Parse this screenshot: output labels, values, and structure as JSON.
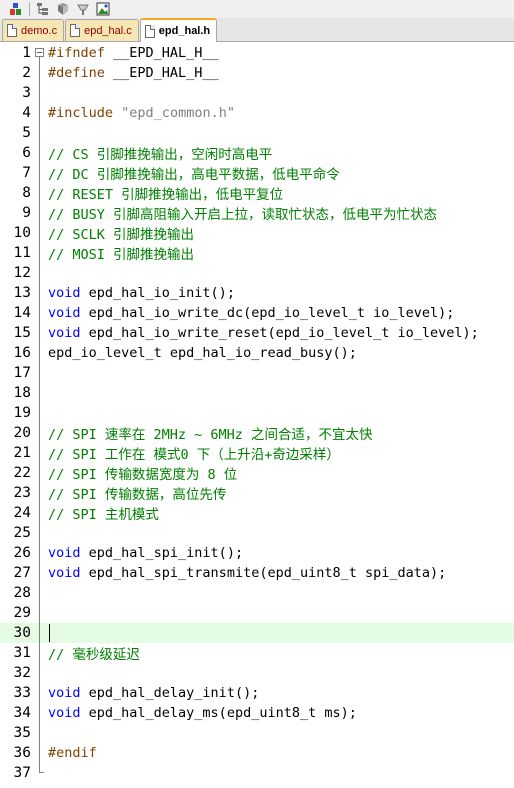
{
  "toolbar": {
    "icons": [
      "shapes-icon",
      "tree-outline-icon",
      "cursor-icon",
      "bookmark-icon",
      "image-icon"
    ]
  },
  "tabs": [
    {
      "label": "demo.c",
      "active": false
    },
    {
      "label": "epd_hal.c",
      "active": false
    },
    {
      "label": "epd_hal.h",
      "active": true
    }
  ],
  "editor": {
    "current_line": 30,
    "lines": [
      {
        "n": "1",
        "text": "#ifndef __EPD_HAL_H__"
      },
      {
        "n": "2",
        "text": "#define __EPD_HAL_H__"
      },
      {
        "n": "3",
        "text": ""
      },
      {
        "n": "4",
        "text": "#include \"epd_common.h\""
      },
      {
        "n": "5",
        "text": ""
      },
      {
        "n": "6",
        "text": "// CS 引脚推挽输出，空闲时高电平"
      },
      {
        "n": "7",
        "text": "// DC 引脚推挽输出，高电平数据，低电平命令"
      },
      {
        "n": "8",
        "text": "// RESET 引脚推挽输出，低电平复位"
      },
      {
        "n": "9",
        "text": "// BUSY 引脚高阻输入开启上拉，读取忙状态，低电平为忙状态"
      },
      {
        "n": "10",
        "text": "// SCLK 引脚推挽输出"
      },
      {
        "n": "11",
        "text": "// MOSI 引脚推挽输出"
      },
      {
        "n": "12",
        "text": ""
      },
      {
        "n": "13",
        "text": "void epd_hal_io_init();"
      },
      {
        "n": "14",
        "text": "void epd_hal_io_write_dc(epd_io_level_t io_level);"
      },
      {
        "n": "15",
        "text": "void epd_hal_io_write_reset(epd_io_level_t io_level);"
      },
      {
        "n": "16",
        "text": "epd_io_level_t epd_hal_io_read_busy();"
      },
      {
        "n": "17",
        "text": ""
      },
      {
        "n": "18",
        "text": ""
      },
      {
        "n": "19",
        "text": ""
      },
      {
        "n": "20",
        "text": "// SPI 速率在 2MHz ~ 6MHz 之间合适，不宜太快"
      },
      {
        "n": "21",
        "text": "// SPI 工作在 模式0 下（上升沿+奇边采样）"
      },
      {
        "n": "22",
        "text": "// SPI 传输数据宽度为 8 位"
      },
      {
        "n": "23",
        "text": "// SPI 传输数据，高位先传"
      },
      {
        "n": "24",
        "text": "// SPI 主机模式"
      },
      {
        "n": "25",
        "text": ""
      },
      {
        "n": "26",
        "text": "void epd_hal_spi_init();"
      },
      {
        "n": "27",
        "text": "void epd_hal_spi_transmite(epd_uint8_t spi_data);"
      },
      {
        "n": "28",
        "text": ""
      },
      {
        "n": "29",
        "text": ""
      },
      {
        "n": "30",
        "text": ""
      },
      {
        "n": "31",
        "text": "// 毫秒级延迟"
      },
      {
        "n": "32",
        "text": ""
      },
      {
        "n": "33",
        "text": "void epd_hal_delay_init();"
      },
      {
        "n": "34",
        "text": "void epd_hal_delay_ms(epd_uint8_t ms);"
      },
      {
        "n": "35",
        "text": ""
      },
      {
        "n": "36",
        "text": "#endif"
      },
      {
        "n": "37",
        "text": ""
      }
    ]
  },
  "colors": {
    "keyword": "#0000ff",
    "comment": "#008000",
    "preprocessor": "#804000",
    "string": "#808080",
    "current_line_bg": "#e4fbe4",
    "active_tab_accent": "#f5a623"
  }
}
